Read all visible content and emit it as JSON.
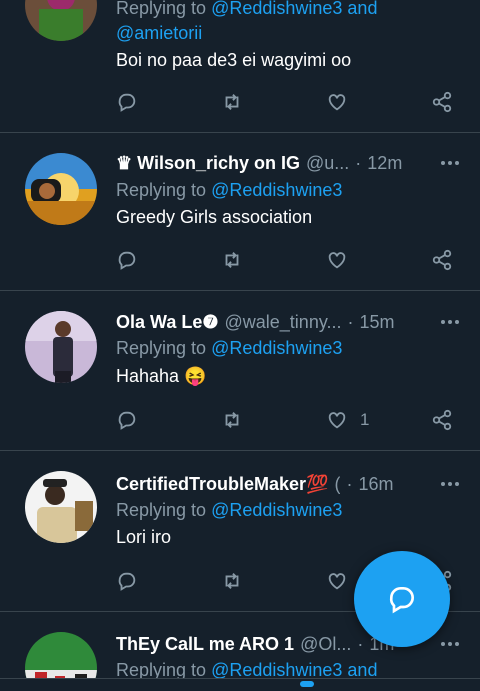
{
  "colors": {
    "background": "#15202b",
    "accent": "#1da1f2",
    "muted": "#8899a6",
    "divider": "#38444d"
  },
  "icons": {
    "reply": "reply-bubble-icon",
    "retweet": "retweet-icon",
    "like": "heart-icon",
    "share": "share-icon",
    "more": "more-dots-icon",
    "compose": "compose-reply-icon"
  },
  "tweets": [
    {
      "name": "",
      "handle": "",
      "time": "",
      "replying_prefix": "Replying to",
      "replying_to": "@Reddishwine3 and",
      "replying_to_line2": "@amietorii",
      "text": "Boi no paa de3 ei wagyimi oo",
      "likes": ""
    },
    {
      "name": "♛ Wilson_richy on IG",
      "handle": "@u...",
      "time": "12m",
      "replying_prefix": "Replying to",
      "replying_to": "@Reddishwine3",
      "text": "Greedy Girls association",
      "likes": ""
    },
    {
      "name": "Ola Wa Le❼",
      "handle": "@wale_tinny...",
      "time": "15m",
      "replying_prefix": "Replying to",
      "replying_to": "@Reddishwine3",
      "text": "Hahaha 😝",
      "likes": "1"
    },
    {
      "name": "CertifiedTroubleMaker💯",
      "handle": "(",
      "time": "16m",
      "replying_prefix": "Replying to",
      "replying_to": "@Reddishwine3",
      "text": "Lori iro",
      "likes": ""
    },
    {
      "name": "ThEy CalL me ARO 1",
      "handle": "@Ol...",
      "time": "1m",
      "replying_prefix": "Replying to",
      "replying_to": "@Reddishwine3 and",
      "text": "",
      "likes": ""
    }
  ]
}
